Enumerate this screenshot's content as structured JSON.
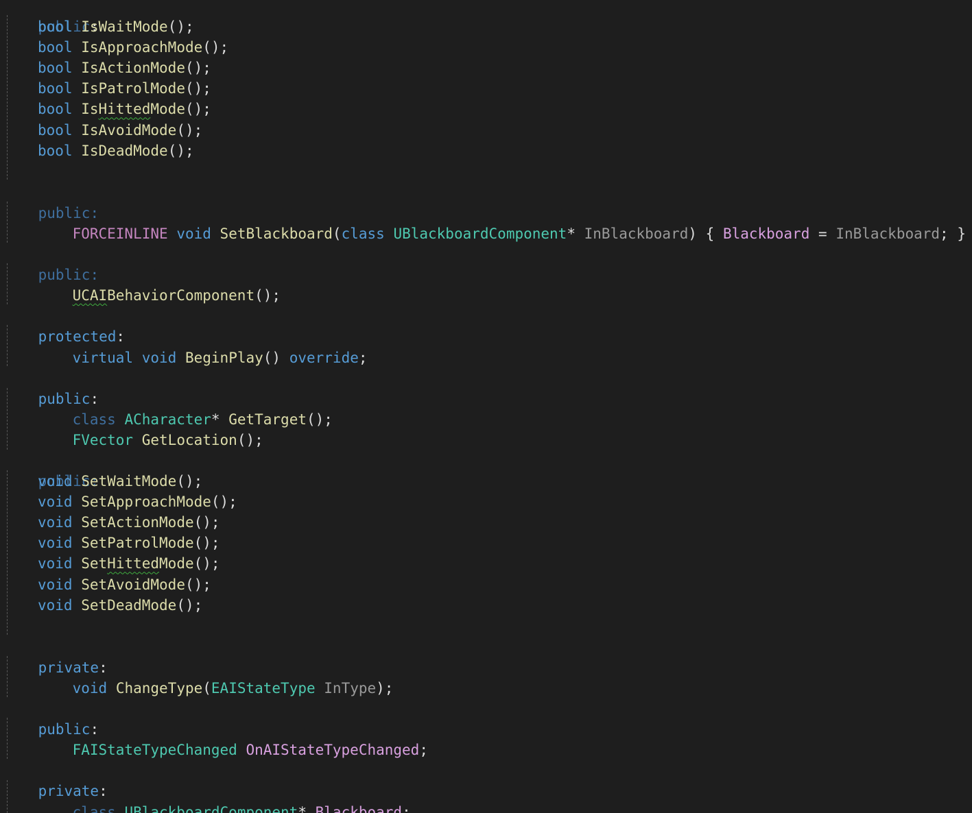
{
  "editor": {
    "colors": {
      "background": "#1e1e1e",
      "keyword": "#569cd6",
      "type": "#4ec9b0",
      "function": "#dcdcaa",
      "parameter": "#9a9a9a",
      "member": "#d8a0df",
      "macro": "#c586c0",
      "squiggle": "#3fae3f"
    }
  },
  "code": {
    "public": "public",
    "protected": "protected",
    "private": "private",
    "colon": ":",
    "bool": "bool",
    "void": "void",
    "class": "class",
    "virtual": "virtual",
    "override": "override",
    "forceinline": "FORCEINLINE",
    "call_end": "();",
    "paren_open": "(",
    "star": "*",
    "semicolon": ";",
    "bool_methods": [
      {
        "prefix": "Is",
        "squiggle": "",
        "suffix": "WaitMode"
      },
      {
        "prefix": "Is",
        "squiggle": "",
        "suffix": "ApproachMode"
      },
      {
        "prefix": "Is",
        "squiggle": "",
        "suffix": "ActionMode"
      },
      {
        "prefix": "Is",
        "squiggle": "",
        "suffix": "PatrolMode"
      },
      {
        "prefix": "Is",
        "squiggle": "Hitted",
        "suffix": "Mode"
      },
      {
        "prefix": "Is",
        "squiggle": "",
        "suffix": "AvoidMode"
      },
      {
        "prefix": "Is",
        "squiggle": "",
        "suffix": "DeadMode"
      }
    ],
    "set_blackboard": {
      "name": "SetBlackboard",
      "param_type": "UBlackboardComponent",
      "param_name": "InBlackboard",
      "body_open": ") { ",
      "member": "Blackboard",
      "assign": " = ",
      "value": "InBlackboard",
      "body_close": "; }"
    },
    "constructor": {
      "squiggle": "UCAI",
      "rest": "BehaviorComponent"
    },
    "begin_play": "BeginPlay",
    "begin_play_paren": "() ",
    "target_type": "ACharacter",
    "get_target": "GetTarget",
    "fvector": "FVector",
    "get_location": "GetLocation",
    "void_methods": [
      {
        "prefix": "Set",
        "squiggle": "",
        "suffix": "WaitMode"
      },
      {
        "prefix": "Set",
        "squiggle": "",
        "suffix": "ApproachMode"
      },
      {
        "prefix": "Set",
        "squiggle": "",
        "suffix": "ActionMode"
      },
      {
        "prefix": "Set",
        "squiggle": "",
        "suffix": "PatrolMode"
      },
      {
        "prefix": "Set",
        "squiggle": "Hitted",
        "suffix": "Mode"
      },
      {
        "prefix": "Set",
        "squiggle": "",
        "suffix": "AvoidMode"
      },
      {
        "prefix": "Set",
        "squiggle": "",
        "suffix": "DeadMode"
      }
    ],
    "change_type": "ChangeType",
    "state_type": "EAIStateType",
    "in_type": "InType",
    "close_paren_semi": ");",
    "delegate_type": "FAIStateTypeChanged",
    "delegate_member": "OnAIStateTypeChanged",
    "bb_type": "UBlackboardComponent",
    "bb_member": "Blackboard"
  }
}
